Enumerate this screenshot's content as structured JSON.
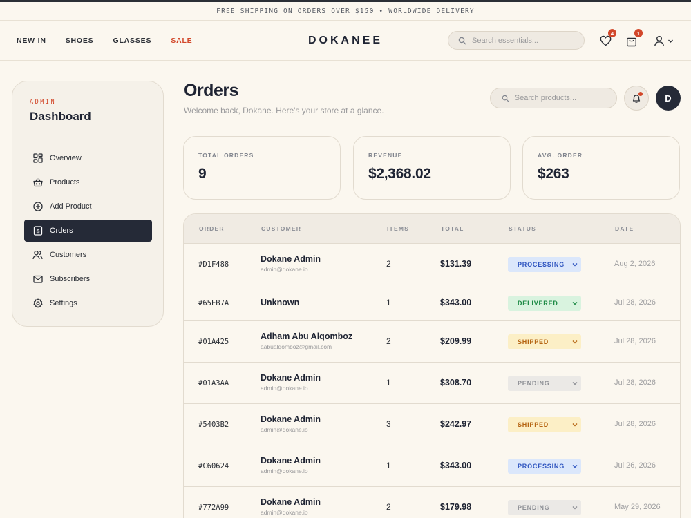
{
  "announcement": "FREE SHIPPING ON ORDERS OVER $150 • WORLDWIDE DELIVERY",
  "header": {
    "nav": [
      "NEW IN",
      "SHOES",
      "GLASSES",
      "SALE"
    ],
    "brand": "DOKANEE",
    "search_placeholder": "Search essentials...",
    "wishlist_count": "4",
    "cart_count": "1"
  },
  "sidebar": {
    "kicker": "ADMIN",
    "title": "Dashboard",
    "items": [
      {
        "label": "Overview",
        "icon": "grid-icon"
      },
      {
        "label": "Products",
        "icon": "basket-icon"
      },
      {
        "label": "Add Product",
        "icon": "plus-circle-icon"
      },
      {
        "label": "Orders",
        "icon": "receipt-icon",
        "active": true
      },
      {
        "label": "Customers",
        "icon": "users-icon"
      },
      {
        "label": "Subscribers",
        "icon": "mail-icon"
      },
      {
        "label": "Settings",
        "icon": "gear-icon"
      }
    ]
  },
  "main": {
    "title": "Orders",
    "subtitle": "Welcome back, Dokane. Here's your store at a glance.",
    "search_placeholder": "Search products...",
    "avatar_initial": "D"
  },
  "stats": [
    {
      "label": "TOTAL ORDERS",
      "value": "9"
    },
    {
      "label": "REVENUE",
      "value": "$2,368.02"
    },
    {
      "label": "AVG. ORDER",
      "value": "$263"
    }
  ],
  "table": {
    "columns": [
      "ORDER",
      "CUSTOMER",
      "ITEMS",
      "TOTAL",
      "STATUS",
      "DATE"
    ],
    "rows": [
      {
        "order": "#D1F488",
        "name": "Dokane Admin",
        "email": "admin@dokane.io",
        "items": "2",
        "total": "$131.39",
        "status": "PROCESSING",
        "date": "Aug 2, 2026"
      },
      {
        "order": "#65EB7A",
        "name": "Unknown",
        "email": "",
        "items": "1",
        "total": "$343.00",
        "status": "DELIVERED",
        "date": "Jul 28, 2026"
      },
      {
        "order": "#01A425",
        "name": "Adham Abu Alqomboz",
        "email": "aabualqomboz@gmail.com",
        "items": "2",
        "total": "$209.99",
        "status": "SHIPPED",
        "date": "Jul 28, 2026"
      },
      {
        "order": "#01A3AA",
        "name": "Dokane Admin",
        "email": "admin@dokane.io",
        "items": "1",
        "total": "$308.70",
        "status": "PENDING",
        "date": "Jul 28, 2026"
      },
      {
        "order": "#5403B2",
        "name": "Dokane Admin",
        "email": "admin@dokane.io",
        "items": "3",
        "total": "$242.97",
        "status": "SHIPPED",
        "date": "Jul 28, 2026"
      },
      {
        "order": "#C60624",
        "name": "Dokane Admin",
        "email": "admin@dokane.io",
        "items": "1",
        "total": "$343.00",
        "status": "PROCESSING",
        "date": "Jul 26, 2026"
      },
      {
        "order": "#772A99",
        "name": "Dokane Admin",
        "email": "admin@dokane.io",
        "items": "2",
        "total": "$179.98",
        "status": "PENDING",
        "date": "May 29, 2026"
      }
    ]
  },
  "colors": {
    "background": "#fbf7ef",
    "accent": "#d2472a",
    "dark": "#252a37"
  }
}
